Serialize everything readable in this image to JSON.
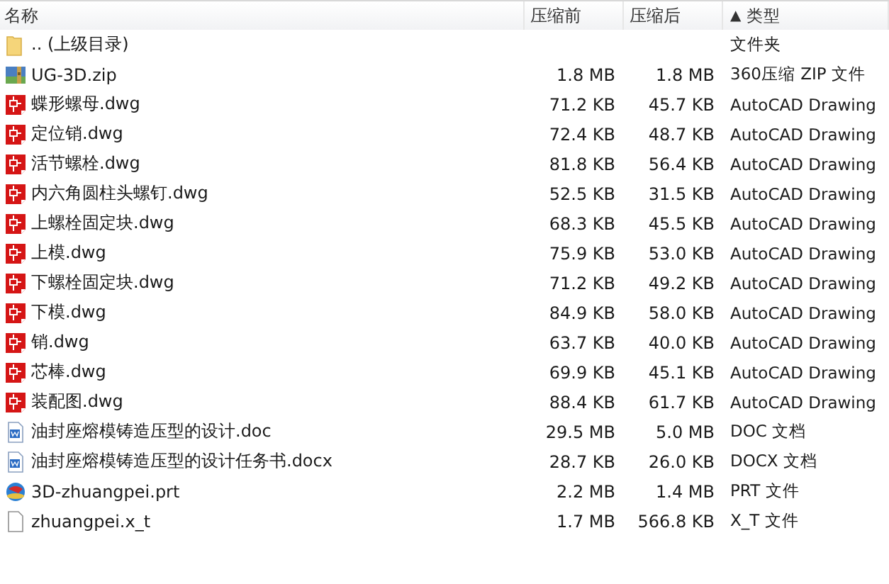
{
  "columns": [
    {
      "label": "名称"
    },
    {
      "label": "压缩前"
    },
    {
      "label": "压缩后"
    },
    {
      "label": "类型",
      "sort_mark": "▲"
    }
  ],
  "rows": [
    {
      "kind": "folder",
      "name": ".. (上级目录)",
      "type": "文件夹"
    },
    {
      "kind": "zip",
      "name": "UG-3D.zip",
      "size": "1.8 MB",
      "packed": "1.8 MB",
      "type": "360压缩 ZIP 文件"
    },
    {
      "kind": "dwg",
      "name": "蝶形螺母.dwg",
      "size": "71.2 KB",
      "packed": "45.7 KB",
      "type": "AutoCAD Drawing"
    },
    {
      "kind": "dwg",
      "name": "定位销.dwg",
      "size": "72.4 KB",
      "packed": "48.7 KB",
      "type": "AutoCAD Drawing"
    },
    {
      "kind": "dwg",
      "name": "活节螺栓.dwg",
      "size": "81.8 KB",
      "packed": "56.4 KB",
      "type": "AutoCAD Drawing"
    },
    {
      "kind": "dwg",
      "name": "内六角圆柱头螺钉.dwg",
      "size": "52.5 KB",
      "packed": "31.5 KB",
      "type": "AutoCAD Drawing"
    },
    {
      "kind": "dwg",
      "name": "上螺栓固定块.dwg",
      "size": "68.3 KB",
      "packed": "45.5 KB",
      "type": "AutoCAD Drawing"
    },
    {
      "kind": "dwg",
      "name": "上模.dwg",
      "size": "75.9 KB",
      "packed": "53.0 KB",
      "type": "AutoCAD Drawing"
    },
    {
      "kind": "dwg",
      "name": "下螺栓固定块.dwg",
      "size": "71.2 KB",
      "packed": "49.2 KB",
      "type": "AutoCAD Drawing"
    },
    {
      "kind": "dwg",
      "name": "下模.dwg",
      "size": "84.9 KB",
      "packed": "58.0 KB",
      "type": "AutoCAD Drawing"
    },
    {
      "kind": "dwg",
      "name": "销.dwg",
      "size": "63.7 KB",
      "packed": "40.0 KB",
      "type": "AutoCAD Drawing"
    },
    {
      "kind": "dwg",
      "name": "芯棒.dwg",
      "size": "69.9 KB",
      "packed": "45.1 KB",
      "type": "AutoCAD Drawing"
    },
    {
      "kind": "dwg",
      "name": "装配图.dwg",
      "size": "88.4 KB",
      "packed": "61.7 KB",
      "type": "AutoCAD Drawing"
    },
    {
      "kind": "doc",
      "name": "油封座熔模铸造压型的设计.doc",
      "size": "29.5 MB",
      "packed": "5.0 MB",
      "type": "DOC 文档"
    },
    {
      "kind": "doc",
      "name": "油封座熔模铸造压型的设计任务书.docx",
      "size": "28.7 KB",
      "packed": "26.0 KB",
      "type": "DOCX 文档"
    },
    {
      "kind": "prt",
      "name": "3D-zhuangpei.prt",
      "size": "2.2 MB",
      "packed": "1.4 MB",
      "type": "PRT 文件"
    },
    {
      "kind": "file",
      "name": "zhuangpei.x_t",
      "size": "1.7 MB",
      "packed": "566.8 KB",
      "type": "X_T 文件"
    }
  ]
}
